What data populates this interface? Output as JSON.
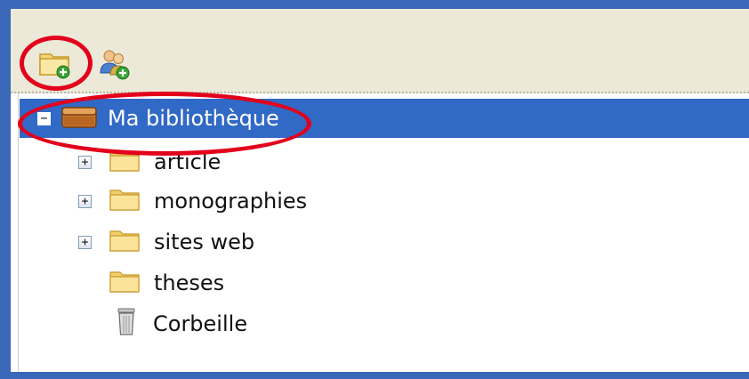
{
  "toolbar": {
    "new_collection": {
      "icon": "folder-add-icon"
    },
    "new_group": {
      "icon": "group-add-icon"
    }
  },
  "tree": {
    "root": {
      "label": "Ma bibliothèque",
      "expander": "−",
      "icon": "library-icon",
      "selected": true
    },
    "items": [
      {
        "label": "article",
        "expander": "+",
        "icon": "folder-icon"
      },
      {
        "label": "monographies",
        "expander": "+",
        "icon": "folder-icon"
      },
      {
        "label": "sites web",
        "expander": "+",
        "icon": "folder-icon"
      },
      {
        "label": "theses",
        "expander": "",
        "icon": "folder-icon"
      },
      {
        "label": "Corbeille",
        "expander": "",
        "icon": "trash-icon"
      }
    ]
  },
  "colors": {
    "frame": "#3a68b8",
    "selection": "#3169c6",
    "toolbar_bg": "#ece9d8",
    "annotation": "#e3001b"
  }
}
